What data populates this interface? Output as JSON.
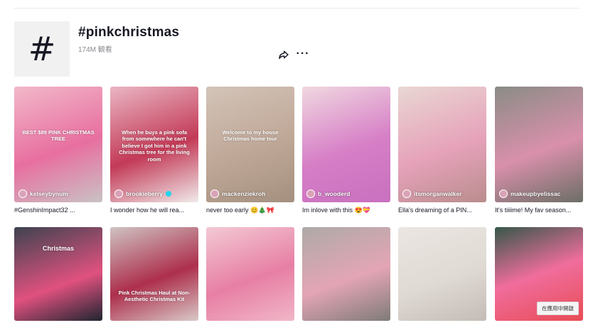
{
  "tag": {
    "title": "#pinkchristmas",
    "views": "174M 観看",
    "hash_symbol": "#"
  },
  "icons": {
    "share": "share-icon",
    "more": "more-icon",
    "more_glyph": "···"
  },
  "videos_row1": [
    {
      "overlay": "BEST $89 PINK CHRISTMAS TREE",
      "username": "kelseybynum",
      "caption": "#GenshinImpact32 ...",
      "bg": "linear-gradient(160deg,#f2b8c9,#e86fa0 55%,#c9c2c4)"
    },
    {
      "overlay": "When he buys a pink sofa from somewhere he can't believe I got him in a pink Christmas tree for the living room",
      "username": "brookieberry",
      "verified": true,
      "caption": "I wonder how he will rea...",
      "bg": "linear-gradient(160deg,#eab6c4,#c33a57 55%,#f0eaea)"
    },
    {
      "overlay": "Welcome to my house Christmas home tour",
      "username": "mackenziekroh",
      "caption": "never too early 😊🎄🎀",
      "bg": "linear-gradient(160deg,#d3c4b8,#bfa797 55%,#a49080)"
    },
    {
      "overlay": "",
      "username": "b_wooderd",
      "caption": "Im inlove with this 😍💝",
      "bg": "linear-gradient(160deg,#f0d8e0,#d67ec6 55%,#c970bf)"
    },
    {
      "overlay": "",
      "username": "itsmorganwalker",
      "caption": "Ella's dreaming of a PIN...",
      "bg": "linear-gradient(160deg,#e9d7d3,#e6a2ba 55%,#b98d8d)"
    },
    {
      "overlay": "",
      "username": "makeupbyelissac",
      "caption": "It's tiiiime! My fav season...",
      "bg": "linear-gradient(160deg,#8a8c86,#d990ab 55%,#6c6e66)"
    }
  ],
  "videos_row2": [
    {
      "overlay": "Christmas",
      "bg": "linear-gradient(160deg,#3d434f,#e0517f 60%,#1f2530)"
    },
    {
      "overlay": "Pink Christmas Haul at Non-Aesthetic Christmas Kit",
      "bg": "linear-gradient(160deg,#cfc3c2,#ad2f4d 55%,#d9c9c7)"
    },
    {
      "overlay": "",
      "bg": "linear-gradient(160deg,#f3c9d4,#e77fa4 55%,#f1b6c8)"
    },
    {
      "overlay": "",
      "bg": "linear-gradient(160deg,#aeaaa7,#e3a5b5 55%,#7f7b79)"
    },
    {
      "overlay": "",
      "bg": "linear-gradient(160deg,#ebe6e2,#e0dad4 55%,#c4bcb6)"
    },
    {
      "overlay": "",
      "open_app": "在應用中開啟",
      "bg": "linear-gradient(160deg,#36584a,#f06d9c 50%,#e84c55)"
    }
  ]
}
